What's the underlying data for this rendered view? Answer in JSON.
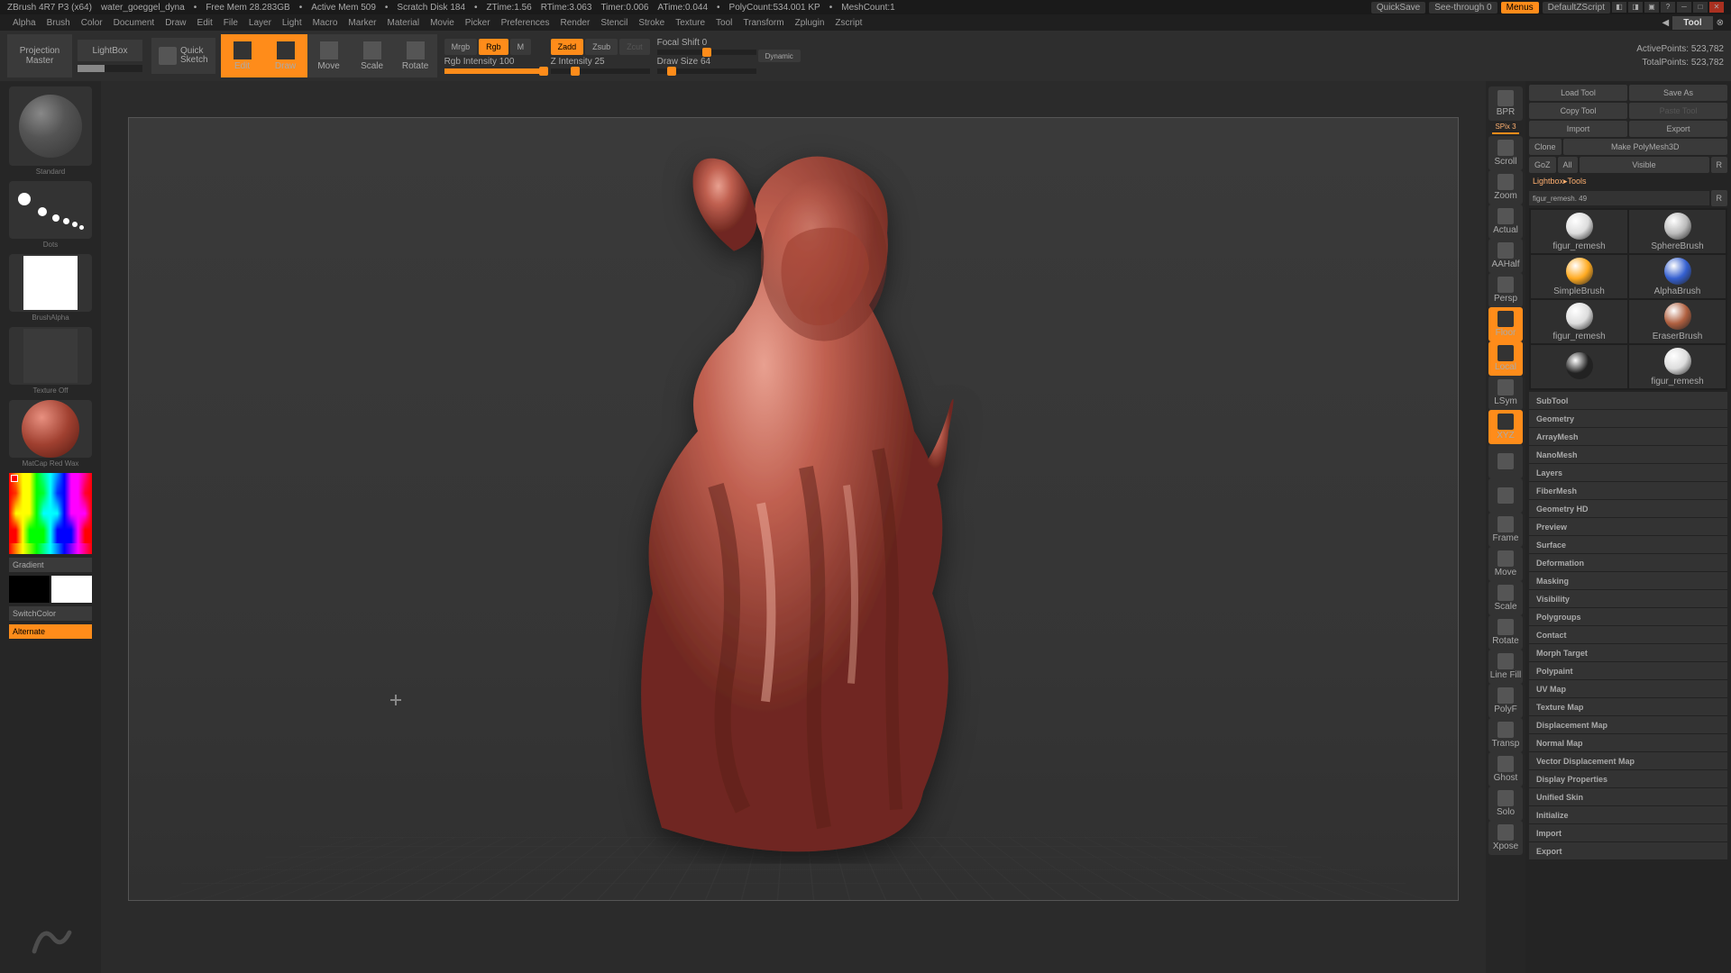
{
  "title": {
    "app": "ZBrush 4R7 P3 (x64)",
    "doc": "water_goeggel_dyna",
    "free_mem": "Free Mem 28.283GB",
    "active_mem": "Active Mem 509",
    "scratch": "Scratch Disk 184",
    "ztime": "ZTime:1.56",
    "rtime": "RTime:3.063",
    "timer": "Timer:0.006",
    "atime": "ATime:0.044",
    "polycount": "PolyCount:534.001 KP",
    "meshcount": "MeshCount:1",
    "quicksave": "QuickSave",
    "seethrough": "See-through   0",
    "menus": "Menus",
    "script": "DefaultZScript"
  },
  "menu": [
    "Alpha",
    "Brush",
    "Color",
    "Document",
    "Draw",
    "Edit",
    "File",
    "Layer",
    "Light",
    "Macro",
    "Marker",
    "Material",
    "Movie",
    "Picker",
    "Preferences",
    "Render",
    "Stencil",
    "Stroke",
    "Texture",
    "Tool",
    "Transform",
    "Zplugin",
    "Zscript"
  ],
  "tool_title": "Tool",
  "shelf": {
    "projection": "Projection\nMaster",
    "lightbox": "LightBox",
    "quicksketch": "Quick\nSketch",
    "modes": [
      "Edit",
      "Draw",
      "Move",
      "Scale",
      "Rotate"
    ],
    "mrgb": "Mrgb",
    "rgb": "Rgb",
    "m": "M",
    "rgb_intensity": "Rgb Intensity 100",
    "zadd": "Zadd",
    "zsub": "Zsub",
    "zcut": "Zcut",
    "z_intensity": "Z Intensity 25",
    "focal": "Focal Shift 0",
    "drawsize": "Draw Size 64",
    "dynamic": "Dynamic",
    "active_pts": "ActivePoints: 523,782",
    "total_pts": "TotalPoints: 523,782"
  },
  "left": {
    "brush": "Standard",
    "stroke": "Dots",
    "alpha": "BrushAlpha",
    "texture": "Texture Off",
    "material": "MatCap Red Wax",
    "gradient": "Gradient",
    "switch": "SwitchColor",
    "alternate": "Alternate"
  },
  "nav": {
    "spix": "SPix 3",
    "buttons": [
      "BPR",
      "Scroll",
      "Zoom",
      "Actual",
      "AAHalf",
      "Persp",
      "Floor",
      "Local",
      "LSym",
      "XYZ",
      "",
      "",
      "Frame",
      "Move",
      "Scale",
      "Rotate",
      "Line Fill",
      "PolyF",
      "Transp",
      "Ghost",
      "Solo",
      "Xpose"
    ]
  },
  "right": {
    "load": "Load Tool",
    "save": "Save As",
    "copy": "Copy Tool",
    "paste": "Paste Tool",
    "import": "Import",
    "export": "Export",
    "clone": "Clone",
    "makepm3d": "Make PolyMesh3D",
    "goz": "GoZ",
    "all": "All",
    "visible": "Visible",
    "r": "R",
    "lightbox_tools": "Lightbox▸Tools",
    "toolname": "figur_remesh. 49",
    "tools": [
      {
        "name": "figur_remesh",
        "color": "#ddd"
      },
      {
        "name": "SphereBrush",
        "color": "#bbb"
      },
      {
        "name": "SimpleBrush",
        "color": "#ffaa20"
      },
      {
        "name": "AlphaBrush",
        "color": "#3560d0"
      },
      {
        "name": "figur_remesh",
        "color": "#ddd"
      },
      {
        "name": "EraserBrush",
        "color": "#b06040"
      },
      {
        "name": "",
        "color": "#222"
      },
      {
        "name": "figur_remesh",
        "color": "#ddd"
      }
    ],
    "sections": [
      "SubTool",
      "Geometry",
      "ArrayMesh",
      "NanoMesh",
      "Layers",
      "FiberMesh",
      "Geometry HD",
      "Preview",
      "Surface",
      "Deformation",
      "Masking",
      "Visibility",
      "Polygroups",
      "Contact",
      "Morph Target",
      "Polypaint",
      "UV Map",
      "Texture Map",
      "Displacement Map",
      "Normal Map",
      "Vector Displacement Map",
      "Display Properties",
      "Unified Skin",
      "Initialize",
      "Import",
      "Export"
    ]
  }
}
